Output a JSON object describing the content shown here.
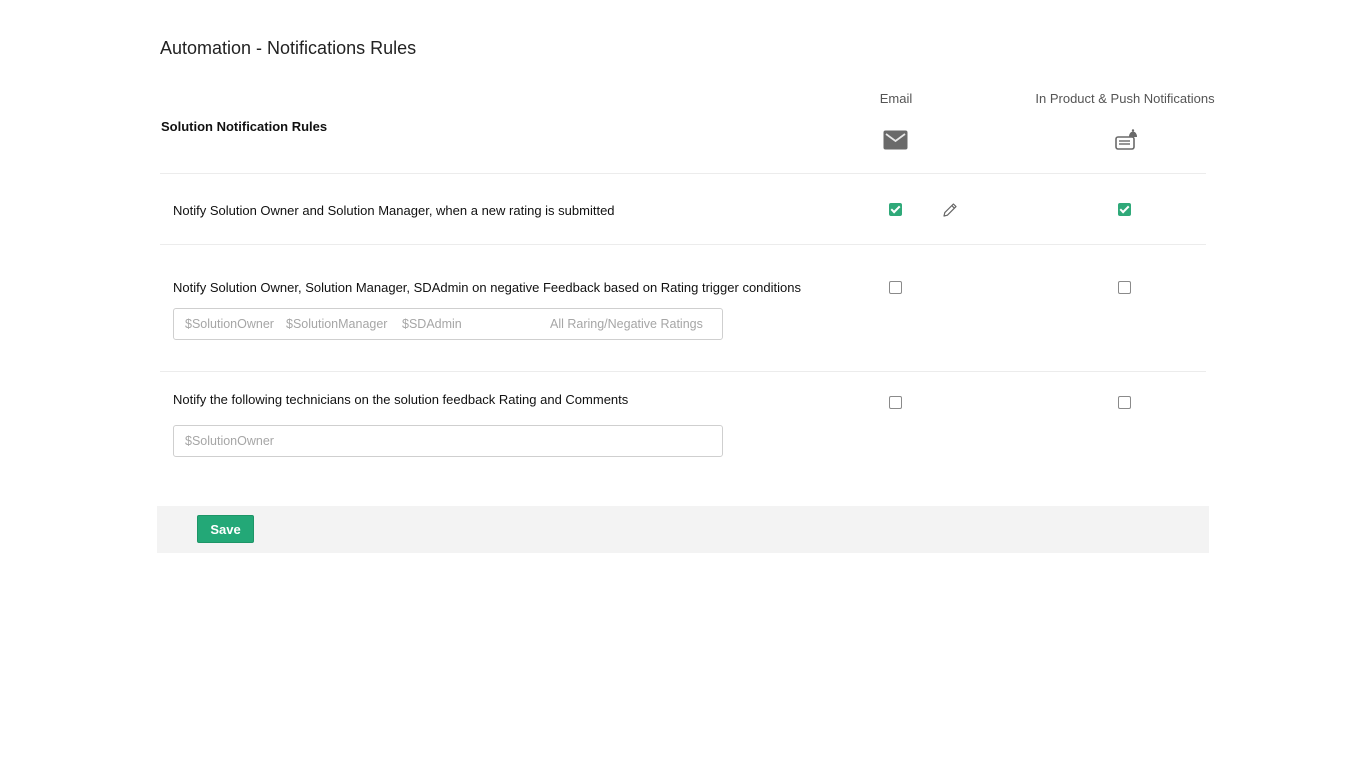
{
  "page": {
    "title": "Automation - Notifications Rules"
  },
  "section": {
    "title": "Solution Notification Rules"
  },
  "columns": {
    "email": "Email",
    "push": "In Product & Push Notifications"
  },
  "icons": {
    "email_header": "envelope-icon",
    "push_header": "notification-bell-icon",
    "edit": "pencil-icon"
  },
  "rules": [
    {
      "text": "Notify Solution Owner and Solution Manager, when a new rating is submitted",
      "email_checked": true,
      "push_checked": true
    },
    {
      "text": "Notify Solution Owner, Solution Manager, SDAdmin on negative Feedback based on Rating trigger conditions",
      "email_checked": false,
      "push_checked": false,
      "field": {
        "tokens": [
          "$SolutionOwner",
          "$SolutionManager",
          "$SDAdmin"
        ],
        "trigger": "All Raring/Negative Ratings"
      }
    },
    {
      "text": "Notify the following technicians on the solution feedback Rating and Comments",
      "email_checked": false,
      "push_checked": false,
      "field": {
        "tokens": [
          "$SolutionOwner"
        ]
      }
    }
  ],
  "footer": {
    "save_label": "Save"
  },
  "colors": {
    "accent": "#23a877",
    "checkbox_checked": "#2fa979"
  }
}
